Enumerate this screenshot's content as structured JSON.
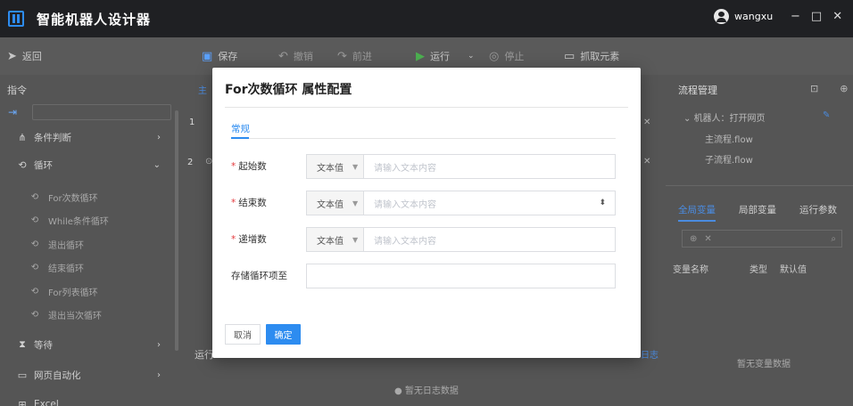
{
  "app": {
    "title": "智能机器人设计器",
    "user": "wangxu"
  },
  "toolbar": {
    "back": "返回",
    "save": "保存",
    "undo": "撤销",
    "redo": "前进",
    "run": "运行",
    "stop": "停止",
    "capture": "抓取元素"
  },
  "sidebar": {
    "title": "指令",
    "items": [
      {
        "label": "条件判断",
        "icon": "branch-icon"
      },
      {
        "label": "循环",
        "icon": "loop-icon"
      }
    ],
    "loop_subitems": [
      "For次数循环",
      "While条件循环",
      "退出循环",
      "结束循环",
      "For列表循环",
      "退出当次循环"
    ],
    "items_after": [
      {
        "label": "等待",
        "icon": "hourglass-icon"
      },
      {
        "label": "网页自动化",
        "icon": "browser-icon"
      },
      {
        "label": "Excel",
        "icon": "excel-icon"
      }
    ]
  },
  "center": {
    "tab_partial": "主",
    "rows": [
      "1",
      "2"
    ],
    "log_label": "运行",
    "log_link": "日志",
    "log_empty": "暂无日志数据"
  },
  "right": {
    "title": "流程管理",
    "tree_root": "机器人：打开网页",
    "tree_children": [
      "主流程.flow",
      "子流程.flow"
    ],
    "tabs": [
      "全局变量",
      "局部变量",
      "运行参数"
    ],
    "columns": [
      "变量名称",
      "类型",
      "默认值"
    ],
    "empty": "暂无变量数据"
  },
  "modal": {
    "title": "For次数循环 属性配置",
    "tab": "常规",
    "fields": [
      {
        "label": "起始数",
        "required": true,
        "type": "文本值",
        "placeholder": "请输入文本内容"
      },
      {
        "label": "结束数",
        "required": true,
        "type": "文本值",
        "placeholder": "请输入文本内容"
      },
      {
        "label": "递增数",
        "required": true,
        "type": "文本值",
        "placeholder": "请输入文本内容"
      }
    ],
    "store_label": "存储循环项至",
    "cancel": "取消",
    "ok": "确定"
  },
  "colors": {
    "accent": "#2d8cf0",
    "titlebar": "#1f2023",
    "overlay": "#555555"
  }
}
